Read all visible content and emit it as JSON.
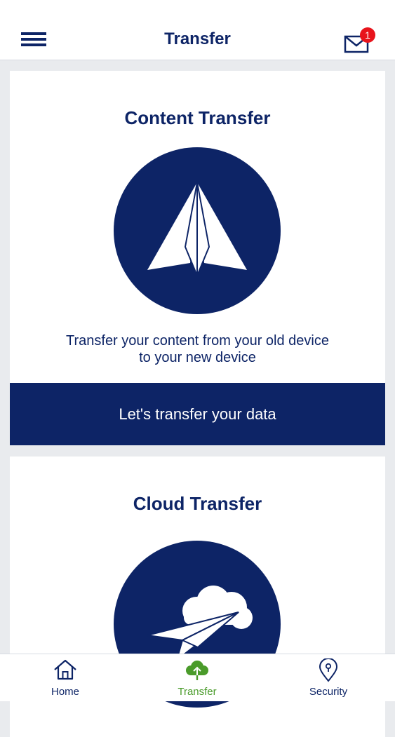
{
  "header": {
    "title": "Transfer",
    "mail_badge": "1"
  },
  "cards": [
    {
      "title": "Content Transfer",
      "description_line1": "Transfer your content from your old device",
      "description_line2": "to your new device",
      "button_label": "Let's transfer your data",
      "icon": "paper-plane-icon"
    },
    {
      "title": "Cloud Transfer",
      "icon": "cloud-paper-plane-icon"
    }
  ],
  "tabs": [
    {
      "label": "Home",
      "icon": "home-icon",
      "active": false
    },
    {
      "label": "Transfer",
      "icon": "cloud-upload-icon",
      "active": true
    },
    {
      "label": "Security",
      "icon": "security-pin-icon",
      "active": false
    }
  ],
  "colors": {
    "brand_navy": "#0d2466",
    "accent_green": "#4a9b2a",
    "badge_red": "#e8141c"
  }
}
